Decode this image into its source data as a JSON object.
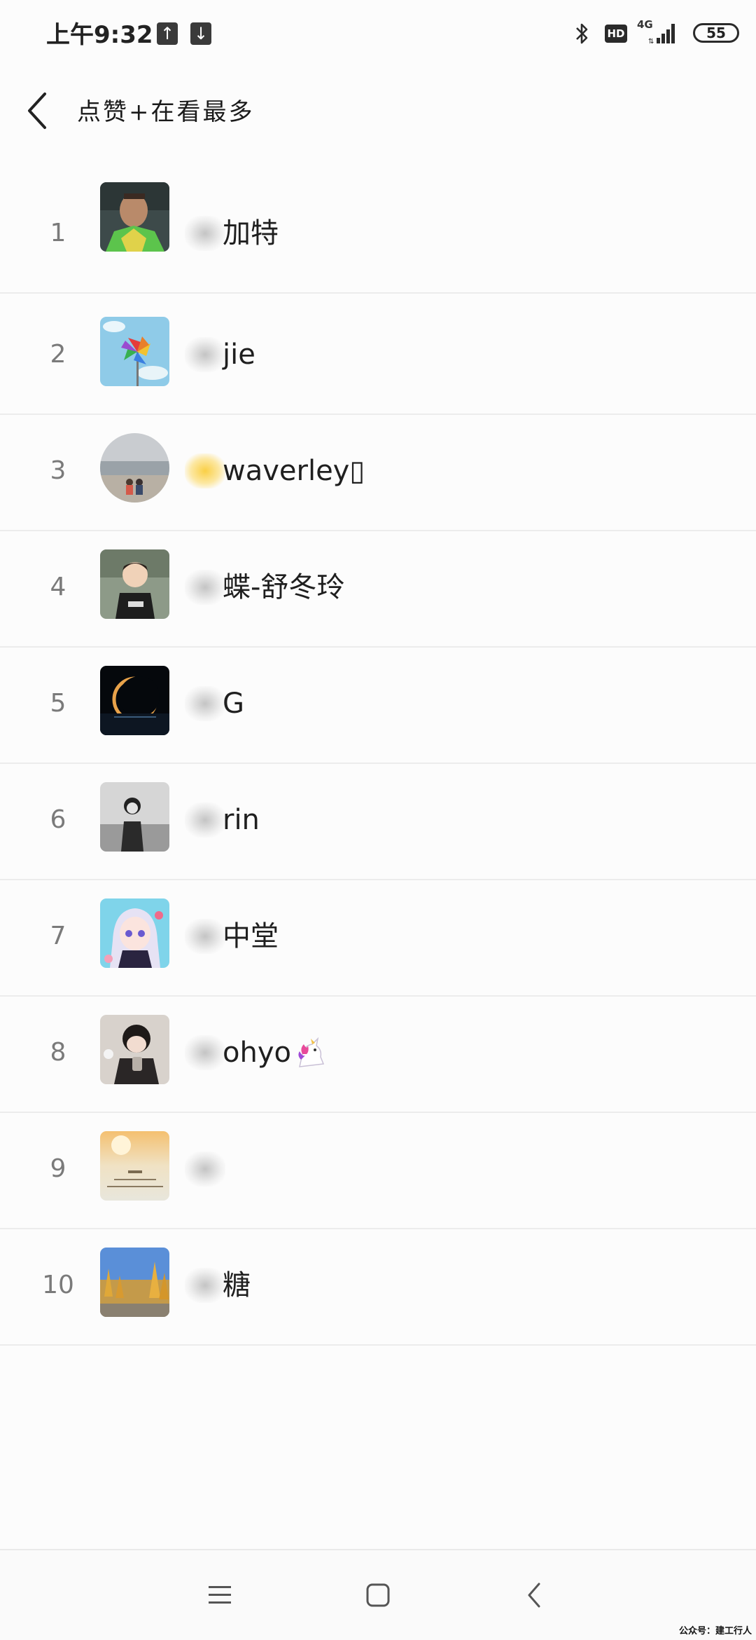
{
  "status_bar": {
    "time": "上午9:32",
    "network": "4G",
    "hd": "HD",
    "battery": "55"
  },
  "header": {
    "title": "点赞+在看最多"
  },
  "ranking": [
    {
      "rank": "1",
      "name": "加特",
      "avatar": "goalkeeper-photo"
    },
    {
      "rank": "2",
      "name": "jie",
      "avatar": "pinwheel-photo"
    },
    {
      "rank": "3",
      "name": "waverley▯",
      "avatar": "beach-couple-photo"
    },
    {
      "rank": "4",
      "name": "蝶-舒冬玲",
      "avatar": "child-photo"
    },
    {
      "rank": "5",
      "name": "G",
      "avatar": "eclipse-photo"
    },
    {
      "rank": "6",
      "name": "rin",
      "avatar": "girl-bw-photo"
    },
    {
      "rank": "7",
      "name": "中堂",
      "avatar": "anime-girl-photo"
    },
    {
      "rank": "8",
      "name": "ohyo",
      "avatar": "baby-photo",
      "emoji": "unicorn-icon"
    },
    {
      "rank": "9",
      "name": "",
      "avatar": "sunset-text-card"
    },
    {
      "rank": "10",
      "name": "糖",
      "avatar": "autumn-trees-photo"
    }
  ],
  "footer": {
    "watermark": "公众号：建工行人"
  }
}
